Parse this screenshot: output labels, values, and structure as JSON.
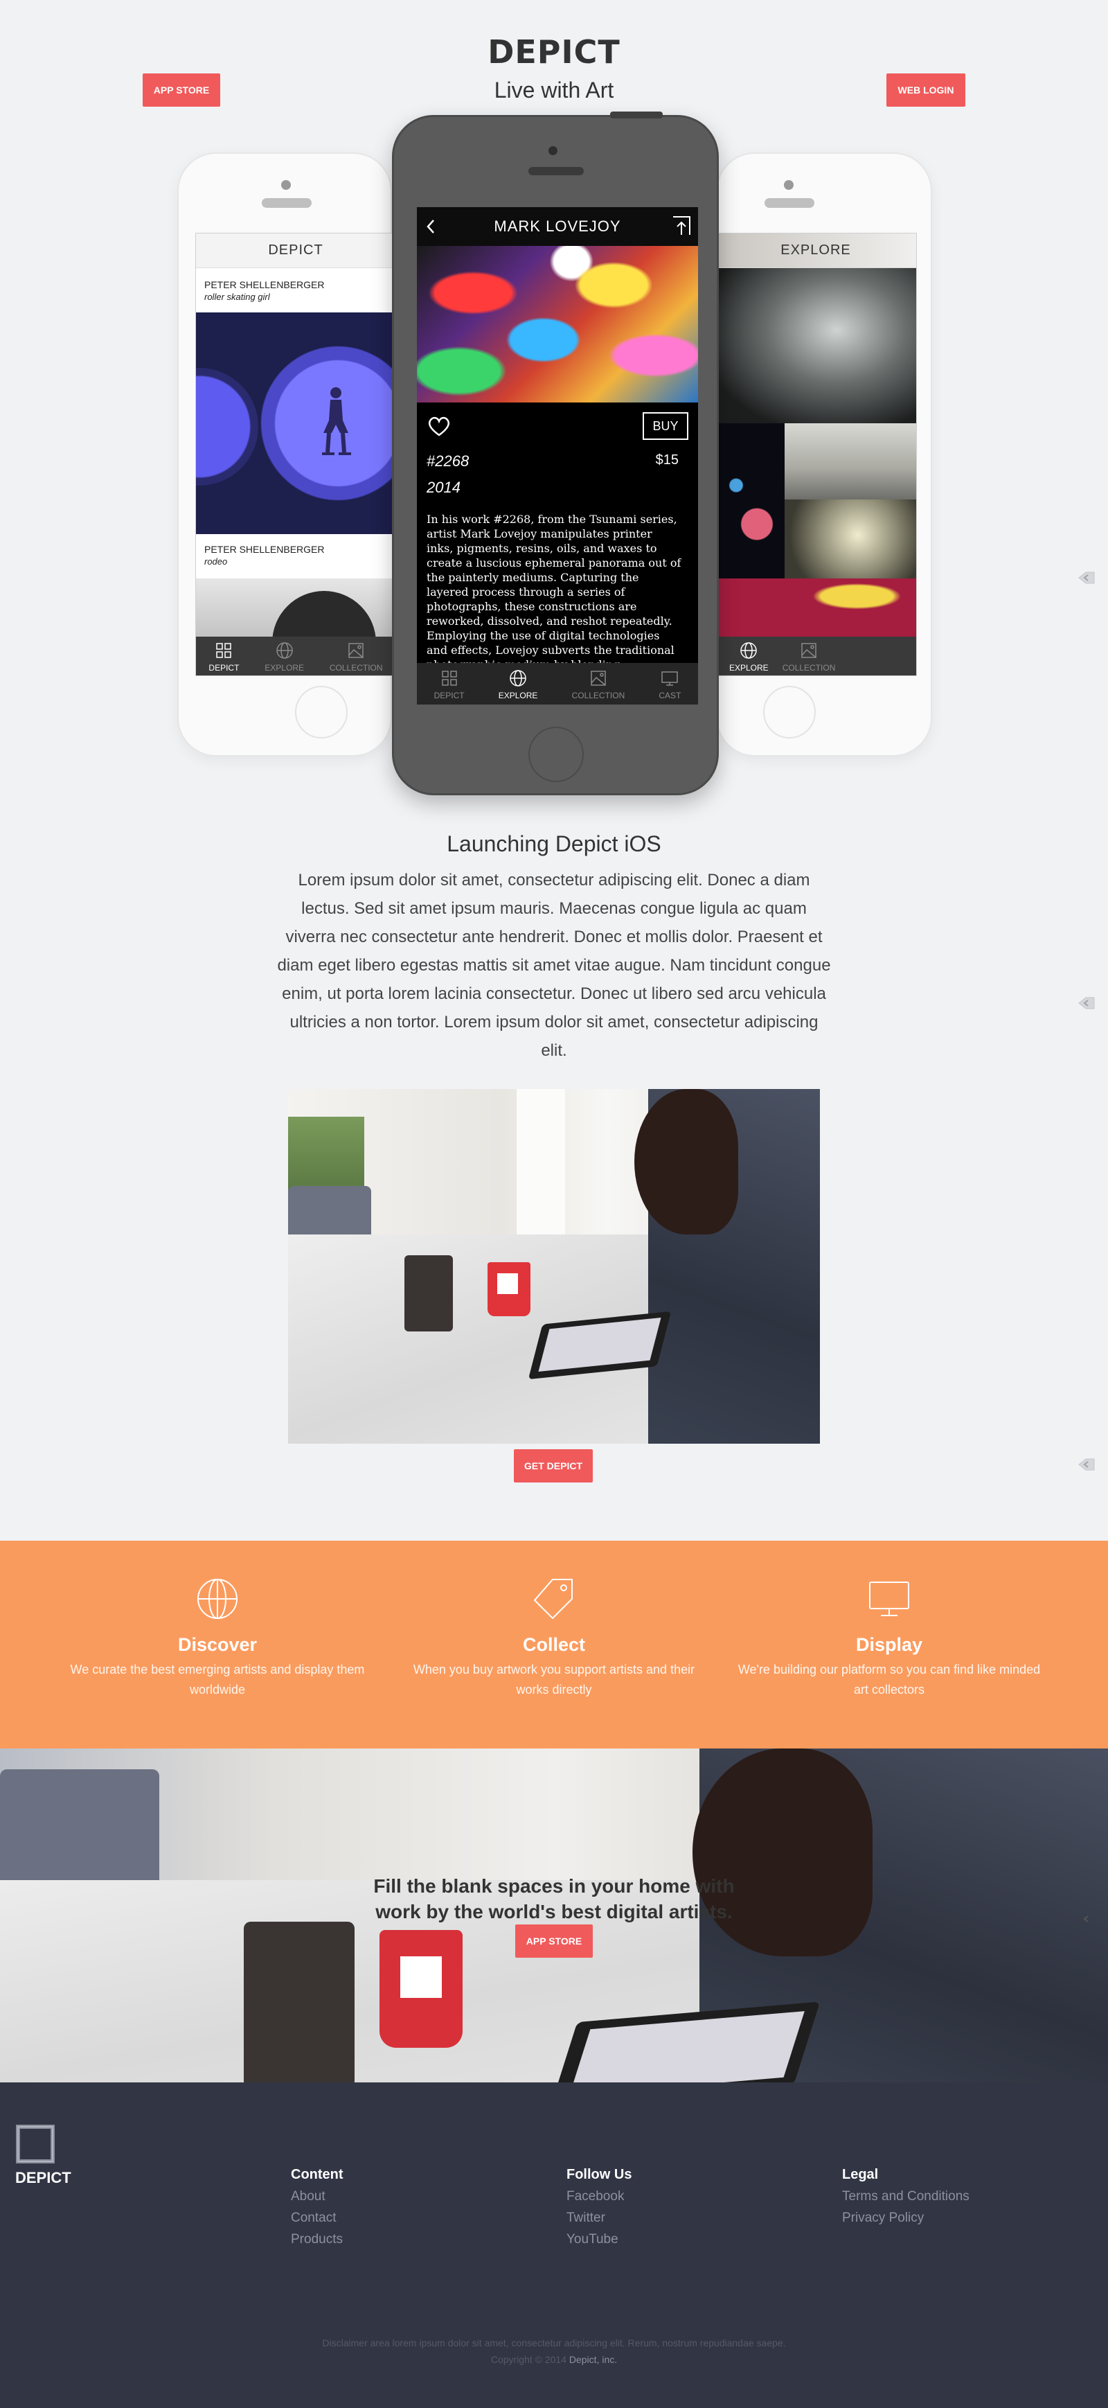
{
  "header": {
    "title": "DEPICT",
    "subtitle": "Live with Art",
    "app_store_label": "APP STORE",
    "web_login_label": "WEB LOGIN"
  },
  "left_phone": {
    "screen_title": "DEPICT",
    "items": [
      {
        "artist": "PETER SHELLENBERGER",
        "work": "roller skating girl"
      },
      {
        "artist": "PETER SHELLENBERGER",
        "work": "rodeo"
      }
    ],
    "tabs": [
      "DEPICT",
      "EXPLORE",
      "COLLECTION"
    ],
    "active_tab": "DEPICT"
  },
  "center_phone": {
    "artist": "MARK LOVEJOY",
    "buy_label": "BUY",
    "artwork_number": "#2268",
    "year": "2014",
    "price": "$15",
    "description": "In his work #2268, from the Tsunami series, artist Mark Lovejoy manipulates printer inks, pigments, resins, oils, and waxes to create a luscious ephemeral panorama out of the painterly mediums. Capturing the layered process through a series of photographs, these constructions are reworked, dissolved, and reshot repeatedly. Employing the use of digital technologies and effects, Lovejoy subverts the traditional photographic medium by blending",
    "tabs": [
      "DEPICT",
      "EXPLORE",
      "COLLECTION",
      "CAST"
    ],
    "active_tab": "EXPLORE"
  },
  "right_phone": {
    "screen_title": "EXPLORE",
    "tabs": [
      "EXPLORE",
      "COLLECTION"
    ],
    "active_tab": "EXPLORE"
  },
  "launch": {
    "title": "Launching Depict iOS",
    "body": "Lorem ipsum dolor sit amet, consectetur adipiscing elit. Donec a diam lectus. Sed sit amet ipsum mauris. Maecenas congue ligula ac quam viverra nec consectetur ante hendrerit. Donec et mollis dolor. Praesent et diam eget libero egestas mattis sit amet vitae augue. Nam tincidunt congue enim, ut porta lorem lacinia consectetur. Donec ut libero sed arcu vehicula ultricies a non tortor. Lorem ipsum dolor sit amet, consectetur adipiscing elit.",
    "cta_label": "GET DEPICT"
  },
  "features": [
    {
      "icon": "globe-icon",
      "title": "Discover",
      "desc": "We curate the best emerging artists and display them worldwide"
    },
    {
      "icon": "tag-icon",
      "title": "Collect",
      "desc": "When you buy artwork you support artists and their works directly"
    },
    {
      "icon": "monitor-icon",
      "title": "Display",
      "desc": "We're building our platform so you can find like minded art collectors"
    }
  ],
  "hero": {
    "caption_line1": "Fill the blank spaces in your home with",
    "caption_line2": "work by the world's best digital artists.",
    "cta_label": "APP STORE"
  },
  "footer": {
    "brand": "DEPICT",
    "columns": [
      {
        "title": "Content",
        "links": [
          "About",
          "Contact",
          "Products"
        ]
      },
      {
        "title": "Follow Us",
        "links": [
          "Facebook",
          "Twitter",
          "YouTube"
        ]
      },
      {
        "title": "Legal",
        "links": [
          "Terms and Conditions",
          "Privacy Policy"
        ]
      }
    ],
    "disclaimer": "Disclaimer area lorem ipsum dolor sit amet, consectetur adipiscing elit. Rerum, nostrum repudiandae saepe.",
    "copyright_prefix": "Copyright © 2014",
    "copyright_company": "Depict, inc."
  },
  "colors": {
    "accent_red": "#f05a5b",
    "feature_orange": "#fa9b5e",
    "footer_bg": "#323543",
    "page_bg": "#f1f2f4"
  }
}
